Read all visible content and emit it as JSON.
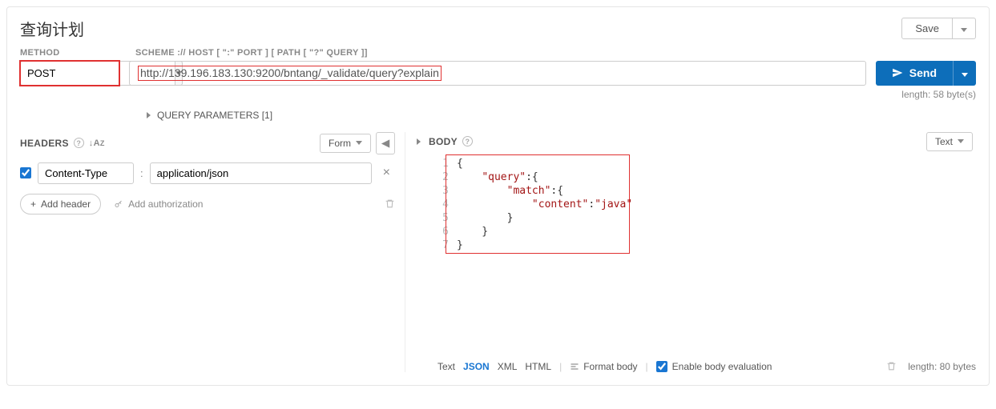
{
  "title": "查询计划",
  "save_label": "Save",
  "method_label": "METHOD",
  "url_label": "SCHEME :// HOST [ \":\" PORT ] [ PATH [ \"?\" QUERY ]]",
  "method": "POST",
  "url": "http://139.196.183.130:9200/bntang/_validate/query?explain",
  "send_label": "Send",
  "length_meta": "length: 58 byte(s)",
  "query_params_label": "QUERY PARAMETERS [1]",
  "headers": {
    "label": "HEADERS",
    "form_label": "Form",
    "row": {
      "checked": true,
      "name": "Content-Type",
      "value": "application/json"
    },
    "add_label": "Add header",
    "auth_label": "Add authorization"
  },
  "body": {
    "label": "BODY",
    "mode_label": "Text",
    "lines": [
      "1",
      "2",
      "3",
      "4",
      "5",
      "6",
      "7"
    ],
    "code": {
      "l1": "{",
      "l2_open": "    ",
      "l2_key": "\"query\"",
      "l2_after": ":{",
      "l3_open": "        ",
      "l3_key": "\"match\"",
      "l3_after": ":{",
      "l4_open": "            ",
      "l4_key": "\"content\"",
      "l4_colon": ":",
      "l4_val": "\"java\"",
      "l5": "        }",
      "l6": "    }",
      "l7": "}"
    },
    "formats": {
      "text": "Text",
      "json": "JSON",
      "xml": "XML",
      "html": "HTML"
    },
    "format_body": "Format body",
    "enable_eval": "Enable body evaluation",
    "length": "length: 80 bytes"
  }
}
